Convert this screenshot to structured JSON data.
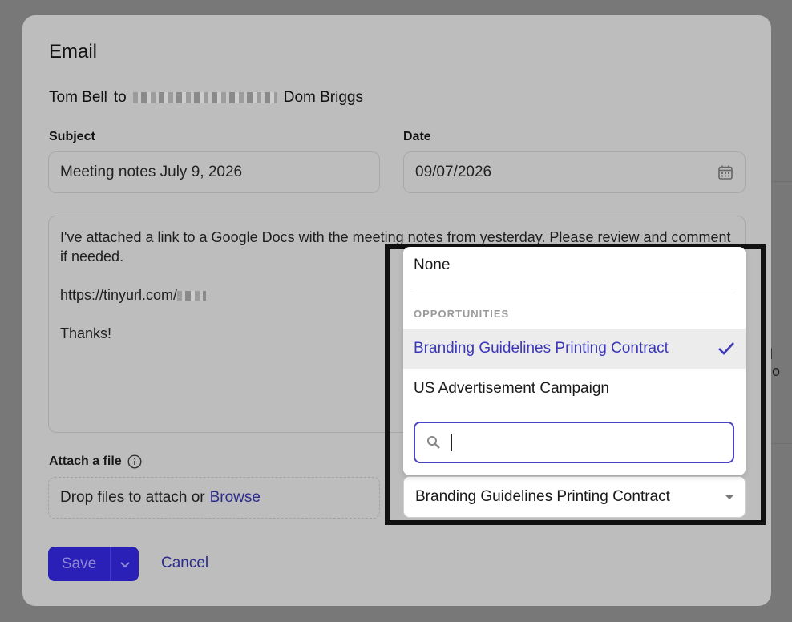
{
  "modal": {
    "title": "Email",
    "from": "Tom Bell",
    "to_word": "to",
    "to_name": "Dom Briggs"
  },
  "subject": {
    "label": "Subject",
    "value": "Meeting notes July 9, 2026"
  },
  "date": {
    "label": "Date",
    "value": "09/07/2026",
    "icon": "calendar-icon"
  },
  "body": {
    "line1": "I've attached a link to a Google Docs with the meeting notes from yesterday. Please review and comment if needed.",
    "link_prefix": "https://tinyurl.com/",
    "signoff": "Thanks!"
  },
  "attach": {
    "label": "Attach a file",
    "drop_text": "Drop files to attach or",
    "browse_label": "Browse"
  },
  "related": {
    "selected_value": "Branding Guidelines Printing Contract"
  },
  "dropdown": {
    "none_label": "None",
    "group_label": "OPPORTUNITIES",
    "options": [
      {
        "label": "Branding Guidelines Printing Contract",
        "selected": true
      },
      {
        "label": "US Advertisement Campaign",
        "selected": false
      }
    ],
    "search_value": ""
  },
  "actions": {
    "save_label": "Save",
    "cancel_label": "Cancel"
  },
  "background": {
    "peek_text": "d co"
  },
  "colors": {
    "accent": "#2a20b8",
    "selected_text": "#3b37b8",
    "highlight_border": "#111111"
  }
}
